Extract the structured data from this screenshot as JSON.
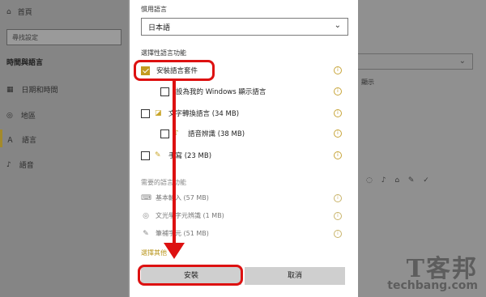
{
  "background": {
    "home_label": "首頁",
    "search_placeholder": "尋找設定",
    "section_title": "時間與語言",
    "nav": [
      {
        "label": "日期和時間",
        "icon": "calendar-icon"
      },
      {
        "label": "地區",
        "icon": "globe-icon"
      },
      {
        "label": "語言",
        "icon": "language-icon"
      },
      {
        "label": "語音",
        "icon": "microphone-icon"
      }
    ],
    "right_fragment": "顯示",
    "accent_color": "#c39a1f"
  },
  "dialog": {
    "preferred_language_label": "慣用語言",
    "selected_language": "日本語",
    "optional_features_label": "選擇性語言功能",
    "options": [
      {
        "label": "安裝語言套件",
        "checked": true,
        "indent": 0,
        "icon": ""
      },
      {
        "label": "設為我的 Windows 顯示語言",
        "checked": false,
        "indent": 1,
        "icon": ""
      },
      {
        "label": "文字轉換語言 (34 MB)",
        "checked": false,
        "indent": 0,
        "icon": "speech-icon"
      },
      {
        "label": "語音辨識 (38 MB)",
        "checked": false,
        "indent": 1,
        "icon": "microphone-icon"
      },
      {
        "label": "手寫 (23 MB)",
        "checked": false,
        "indent": 0,
        "icon": "pen-icon"
      }
    ],
    "required_label": "需要的語言功能",
    "required": [
      {
        "label": "基本輸入 (57 MB)",
        "icon": "keyboard-icon"
      },
      {
        "label": "文光學字元辨識 (1 MB)",
        "icon": "ocr-icon"
      },
      {
        "label": "筆補字元 (51 MB)",
        "icon": "pen-icon"
      }
    ],
    "link": "選擇其他",
    "install_button": "安裝",
    "cancel_button": "取消"
  },
  "watermark": {
    "chinese": "T客邦",
    "english": "techbang.com"
  }
}
